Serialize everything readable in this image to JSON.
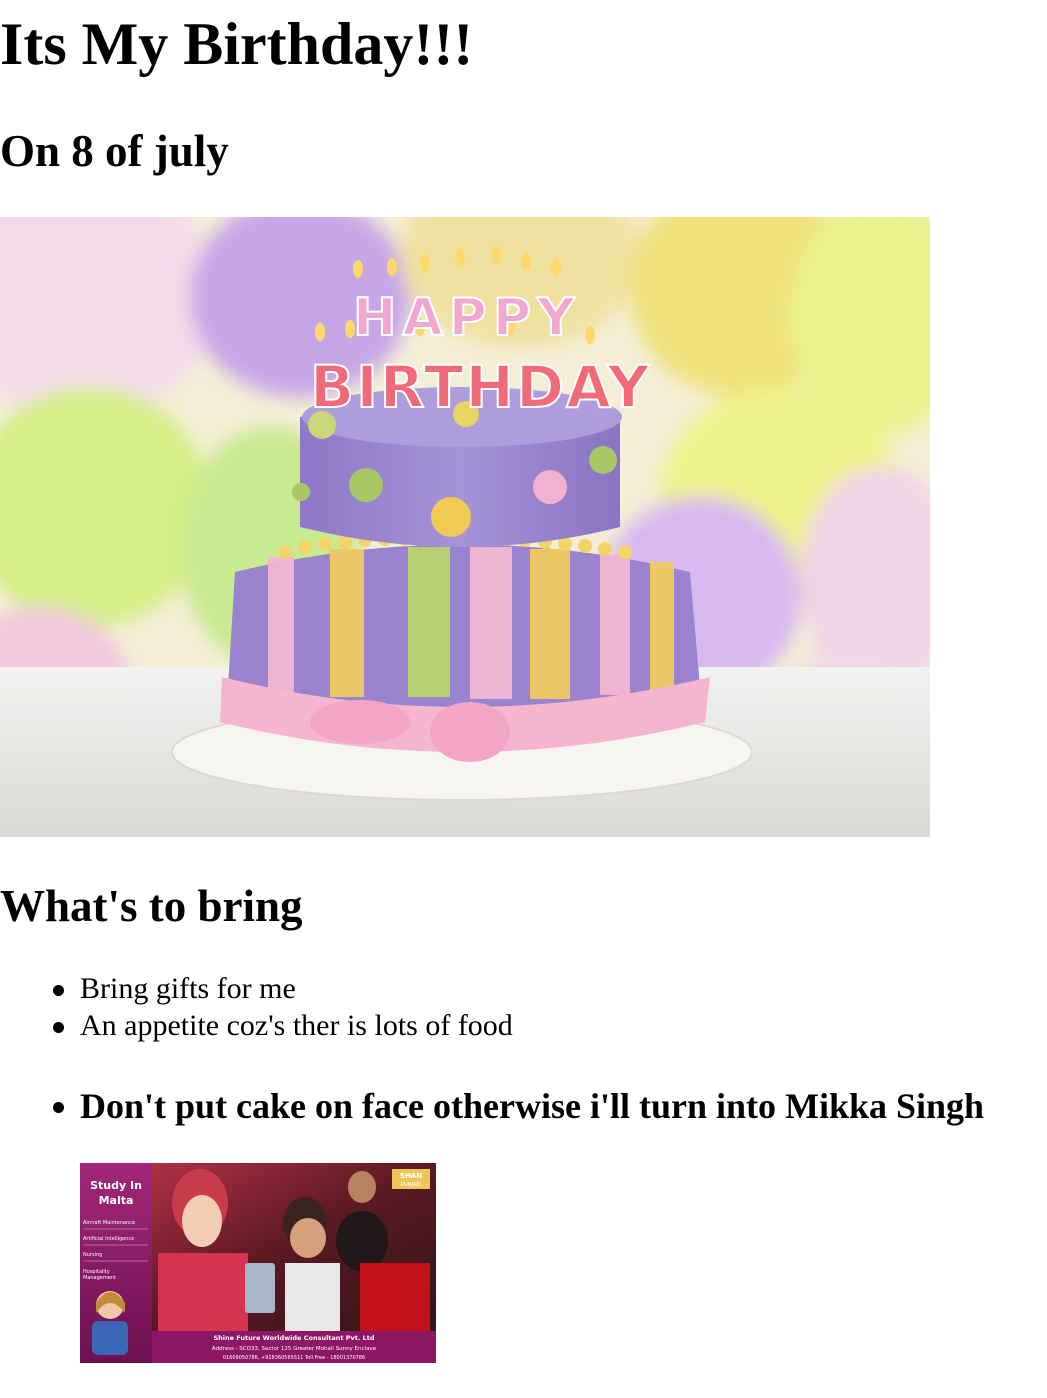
{
  "page": {
    "title": "Its My Birthday!!!",
    "date": "On 8 of july"
  },
  "cake_image": {
    "topper_line1": "HAPPY",
    "topper_line2": "BIRTHDAY"
  },
  "bring_section": {
    "heading": "What's to bring",
    "items": [
      "Bring gifts for me",
      "An appetite coz's ther is lots of food"
    ],
    "bold_item": "Don't put cake on face otherwise i'll turn into Mikka Singh"
  },
  "ad_image": {
    "headline_line1": "Study In",
    "headline_line2": "Malta",
    "courses": [
      "Aircraft Maintenance",
      "Artificial Intelligence",
      "Nursing",
      "Hospitality",
      "Management"
    ],
    "badge_line1": "SHAN",
    "badge_line2": "PUNJABI",
    "company": "Shine Future Worldwide Consultant Pvt. Ltd",
    "address": "Address - SCO33, Sector 125 Greater Mohali Sunny Enclave",
    "contact": "01609050786,   +918360565511   Toll Free - 18001370786"
  },
  "colors": {
    "text": "#000000",
    "background": "#ffffff",
    "cake_purple": "#9a83cf",
    "ad_magenta": "#9a1a6b"
  }
}
